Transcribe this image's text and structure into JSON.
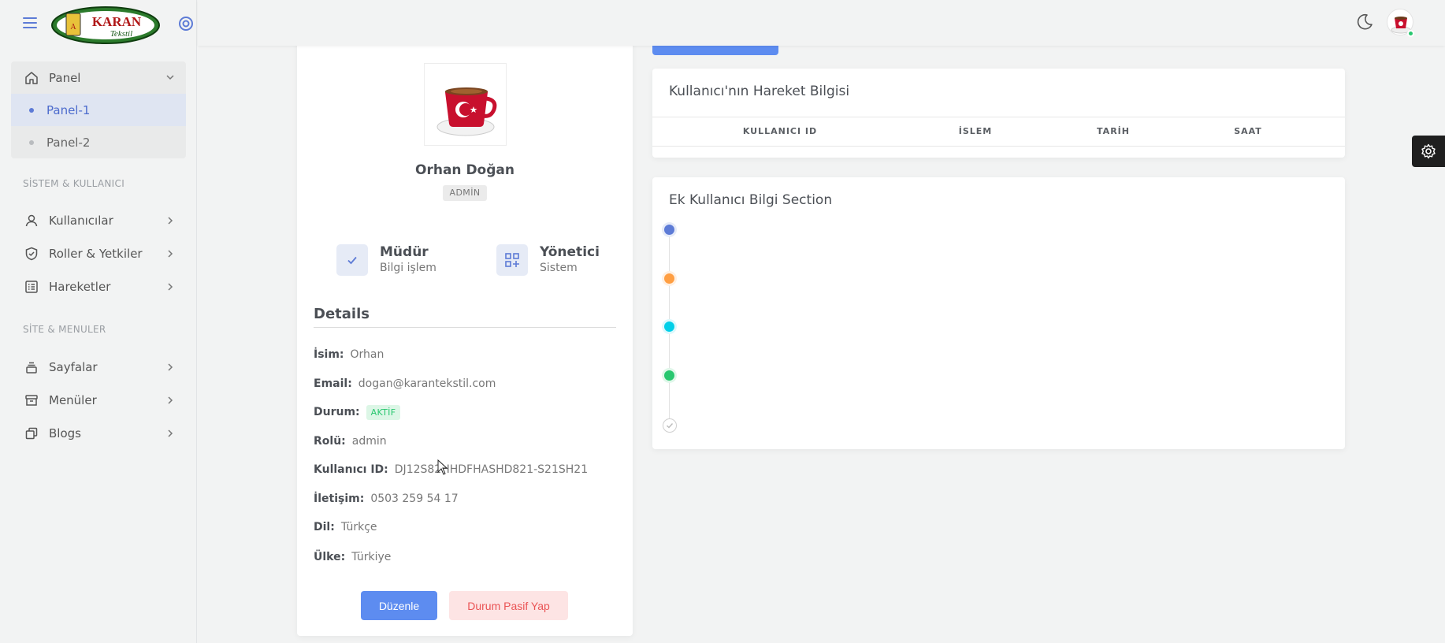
{
  "brand": {
    "logo_text_top": "KARAN",
    "logo_text_bottom": "Tekstil"
  },
  "sidebar": {
    "panel_label": "Panel",
    "panel_items": [
      {
        "label": "Panel-1",
        "active": true
      },
      {
        "label": "Panel-2",
        "active": false
      }
    ],
    "section1_title": "SİSTEM & KULLANICI",
    "section1_items": [
      {
        "label": "Kullanıcılar",
        "icon": "user-icon"
      },
      {
        "label": "Roller & Yetkiler",
        "icon": "shield-check-icon"
      },
      {
        "label": "Hareketler",
        "icon": "list-icon"
      }
    ],
    "section2_title": "SİTE & MENULER",
    "section2_items": [
      {
        "label": "Sayfalar",
        "icon": "stack-icon"
      },
      {
        "label": "Menüler",
        "icon": "archive-icon"
      },
      {
        "label": "Blogs",
        "icon": "copy-icon"
      }
    ]
  },
  "profile": {
    "name": "Orhan Doğan",
    "role_badge": "ADMİN",
    "stat1": {
      "title": "Müdür",
      "subtitle": "Bilgi işlem"
    },
    "stat2": {
      "title": "Yönetici",
      "subtitle": "Sistem"
    },
    "details_title": "Details",
    "details": [
      {
        "label": "İsim:",
        "value": "Orhan"
      },
      {
        "label": "Email:",
        "value": "dogan@karantekstil.com"
      },
      {
        "label": "Durum:",
        "value": "AKTİF"
      },
      {
        "label": "Rolü:",
        "value": "admin"
      },
      {
        "label": "Kullanıcı ID:",
        "value": "DJ12S82HHDFHASHD821-S21SH21"
      },
      {
        "label": "İletişim:",
        "value": "0503 259 54 17"
      },
      {
        "label": "Dil:",
        "value": "Türkçe"
      },
      {
        "label": "Ülke:",
        "value": "Türkiye"
      }
    ],
    "edit_button": "Düzenle",
    "passive_button": "Durum Pasif Yap"
  },
  "activity_card": {
    "title": "Kullanıcı'nın Hareket Bilgisi",
    "columns": [
      "KULLANICI ID",
      "İSLEM",
      "TARİH",
      "SAAT"
    ]
  },
  "extra_card": {
    "title": "Ek Kullanıcı Bilgi Section",
    "timeline_colors": [
      "#5d7bd6",
      "#ff9f43",
      "#00cfe8",
      "#28c76f"
    ]
  },
  "colors": {
    "primary": "#5d8cf0",
    "success": "#28c76f",
    "danger": "#ea5455"
  }
}
